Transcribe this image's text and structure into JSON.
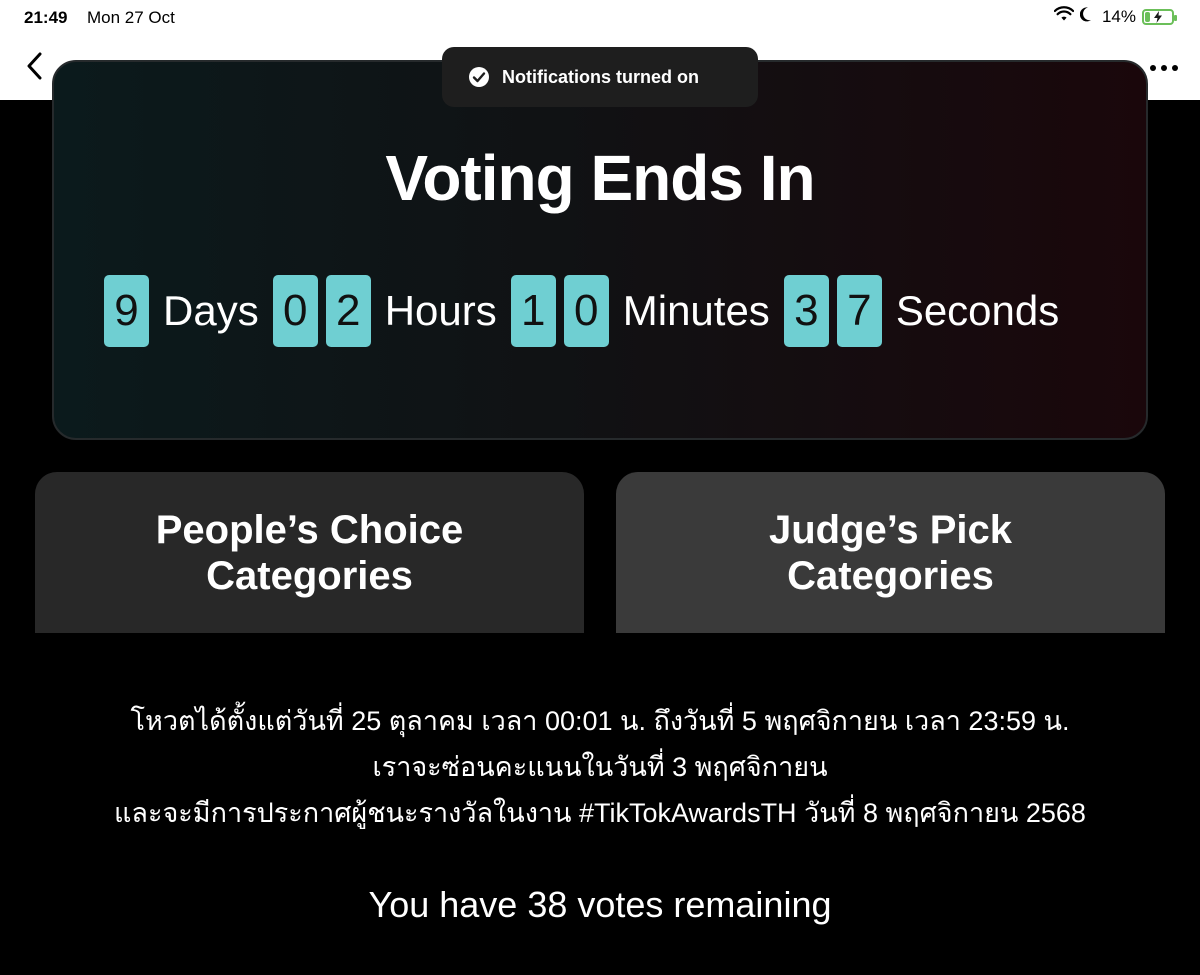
{
  "status_bar": {
    "time": "21:49",
    "date": "Mon 27 Oct",
    "battery": "14%",
    "icons": [
      "wifi-icon",
      "moon-icon",
      "battery-charging-icon"
    ]
  },
  "toast": {
    "text": "Notifications turned on",
    "icon": "check-circle-icon"
  },
  "nav": {
    "back_icon": "chevron-left-icon",
    "more_icon": "more-horizontal-icon"
  },
  "countdown": {
    "title": "Voting Ends In",
    "days_digits": [
      "9"
    ],
    "days_label": "Days",
    "hours_digits": [
      "0",
      "2"
    ],
    "hours_label": "Hours",
    "minutes_digits": [
      "1",
      "0"
    ],
    "minutes_label": "Minutes",
    "seconds_digits": [
      "3",
      "7"
    ],
    "seconds_label": "Seconds",
    "digit_color": "#6fcfd2"
  },
  "categories": [
    {
      "line1": "People’s Choice",
      "line2": "Categories"
    },
    {
      "line1": "Judge’s Pick",
      "line2": "Categories"
    }
  ],
  "info": {
    "line1": "โหวตได้ตั้งแต่วันที่ 25 ตุลาคม เวลา 00:01 น. ถึงวันที่ 5 พฤศจิกายน เวลา 23:59 น.",
    "line2": "เราจะซ่อนคะแนนในวันที่ 3 พฤศจิกายน",
    "line3": "และจะมีการประกาศผู้ชนะรางวัลในงาน #TikTokAwardsTH วันที่ 8 พฤศจิกายน 2568"
  },
  "votes_remaining": "You have 38 votes remaining"
}
